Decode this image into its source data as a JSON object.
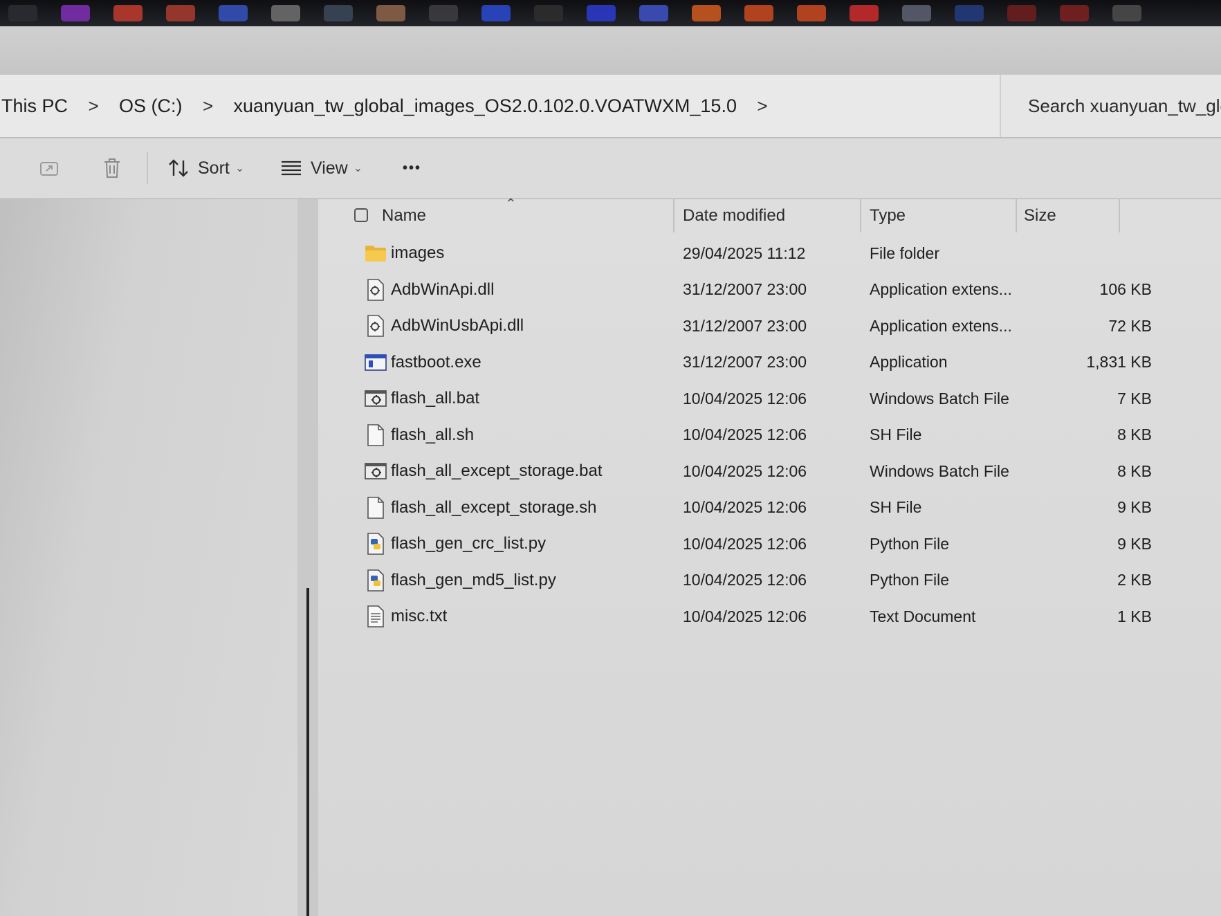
{
  "taskbar": {
    "icons": [
      {
        "name": "chrome-icon",
        "color": "#2b2b33"
      },
      {
        "name": "firefox-icon",
        "color": "#7a2fae"
      },
      {
        "name": "gmail-icon",
        "color": "#b83a2e"
      },
      {
        "name": "gmail-alt-icon",
        "color": "#a23a2c"
      },
      {
        "name": "calendar-icon",
        "color": "#3450b8"
      },
      {
        "name": "tool-icon",
        "color": "#6b6b6b"
      },
      {
        "name": "chart-icon",
        "color": "#3a4658"
      },
      {
        "name": "photo-icon",
        "color": "#8a6048"
      },
      {
        "name": "circle-icon",
        "color": "#3c3c40"
      },
      {
        "name": "chat-icon",
        "color": "#2a48c8"
      },
      {
        "name": "hat-icon",
        "color": "#2e2e2e"
      },
      {
        "name": "bracket-icon",
        "color": "#2a3ac8"
      },
      {
        "name": "app-icon",
        "color": "#3e4fbe"
      },
      {
        "name": "mi-icon",
        "color": "#c8561e"
      },
      {
        "name": "diamond-icon",
        "color": "#c2471f"
      },
      {
        "name": "diamond-alt-icon",
        "color": "#c2471f"
      },
      {
        "name": "s-icon",
        "color": "#c42a2a"
      },
      {
        "name": "person-icon",
        "color": "#5a5d6e"
      },
      {
        "name": "edge-icon",
        "color": "#233a7a"
      },
      {
        "name": "red-app-icon",
        "color": "#6a1e1e"
      },
      {
        "name": "red-app-alt-icon",
        "color": "#7a2020"
      },
      {
        "name": "round-icon",
        "color": "#4a4a4a"
      }
    ]
  },
  "address": {
    "crumbs": [
      "This PC",
      "OS (C:)",
      "xuanyuan_tw_global_images_OS2.0.102.0.VOATWXM_15.0"
    ],
    "separator": ">",
    "search_placeholder": "Search xuanyuan_tw_glo"
  },
  "commands": {
    "sort_label": "Sort",
    "view_label": "View",
    "more_label": "•••"
  },
  "columns": {
    "name": "Name",
    "date": "Date modified",
    "type": "Type",
    "size": "Size"
  },
  "files": [
    {
      "name": "images",
      "date": "29/04/2025 11:12",
      "type": "File folder",
      "size": "",
      "icon": "folder-icon"
    },
    {
      "name": "AdbWinApi.dll",
      "date": "31/12/2007 23:00",
      "type": "Application extens...",
      "size": "106 KB",
      "icon": "dll-file-icon"
    },
    {
      "name": "AdbWinUsbApi.dll",
      "date": "31/12/2007 23:00",
      "type": "Application extens...",
      "size": "72 KB",
      "icon": "dll-file-icon"
    },
    {
      "name": "fastboot.exe",
      "date": "31/12/2007 23:00",
      "type": "Application",
      "size": "1,831 KB",
      "icon": "exe-file-icon"
    },
    {
      "name": "flash_all.bat",
      "date": "10/04/2025 12:06",
      "type": "Windows Batch File",
      "size": "7 KB",
      "icon": "bat-file-icon"
    },
    {
      "name": "flash_all.sh",
      "date": "10/04/2025 12:06",
      "type": "SH File",
      "size": "8 KB",
      "icon": "blank-file-icon"
    },
    {
      "name": "flash_all_except_storage.bat",
      "date": "10/04/2025 12:06",
      "type": "Windows Batch File",
      "size": "8 KB",
      "icon": "bat-file-icon"
    },
    {
      "name": "flash_all_except_storage.sh",
      "date": "10/04/2025 12:06",
      "type": "SH File",
      "size": "9 KB",
      "icon": "blank-file-icon"
    },
    {
      "name": "flash_gen_crc_list.py",
      "date": "10/04/2025 12:06",
      "type": "Python File",
      "size": "9 KB",
      "icon": "python-file-icon"
    },
    {
      "name": "flash_gen_md5_list.py",
      "date": "10/04/2025 12:06",
      "type": "Python File",
      "size": "2 KB",
      "icon": "python-file-icon"
    },
    {
      "name": "misc.txt",
      "date": "10/04/2025 12:06",
      "type": "Text Document",
      "size": "1 KB",
      "icon": "text-file-icon"
    }
  ]
}
